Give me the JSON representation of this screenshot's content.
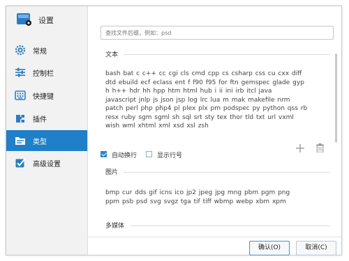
{
  "app": {
    "title": "设置"
  },
  "sidebar": {
    "items": [
      {
        "label": "常规",
        "icon": "gear-icon"
      },
      {
        "label": "控制栏",
        "icon": "sliders-icon"
      },
      {
        "label": "快捷键",
        "icon": "keyboard-icon"
      },
      {
        "label": "插件",
        "icon": "plugin-icon"
      },
      {
        "label": "类型",
        "icon": "folder-icon",
        "active": true
      },
      {
        "label": "高级设置",
        "icon": "checkbox-icon"
      }
    ]
  },
  "search": {
    "placeholder": "查找文件后缀，例如：psd"
  },
  "text_section": {
    "title": "文本",
    "lines": [
      "bash  bat  c  c++  cc  cgi  cls  cmd  cpp  cs  csharp  css  cu  cxx  diff",
      "dtd  ebuild  ecf  eclass  ent  f  f90  f95  for  ftn  gemspec  glade  gyp",
      "h  h++  hdr  hh  hpp  htm  html  hub  i  ii  ini  irb  itcl  java",
      "javascript  jnlp  js  json  jsp  log  lrc  lua  m  mak  makefile  nrm",
      "patch  perl  php  php4  pl  plex  plx  pm  podspec  py  python  qss  rb",
      "resx  ruby  sgm  sgml  sh  sql  srt  sty  tex  thor  tld  txt  url  vxml",
      "wish  wml  xhtml  xml  xsd  xsl  zsh"
    ],
    "wrap_label": "自动换行",
    "line_number_label": "显示行号",
    "wrap_checked": true,
    "line_number_checked": false
  },
  "image_section": {
    "title": "图片",
    "lines": [
      "bmp  cur  dds  gif  icns  ico  jp2  jpeg  jpg  mng  pbm  pgm  png",
      "ppm  psb  psd  svg  svgz  tga  tif  tiff  wbmp  webp  xbm  xpm"
    ]
  },
  "media_section": {
    "title": "多媒体"
  },
  "buttons": {
    "ok": "确认(O)",
    "cancel": "取消(C)"
  },
  "colors": {
    "accent": "#1f7fc8",
    "sidebar_bg": "#f2f2f2"
  }
}
